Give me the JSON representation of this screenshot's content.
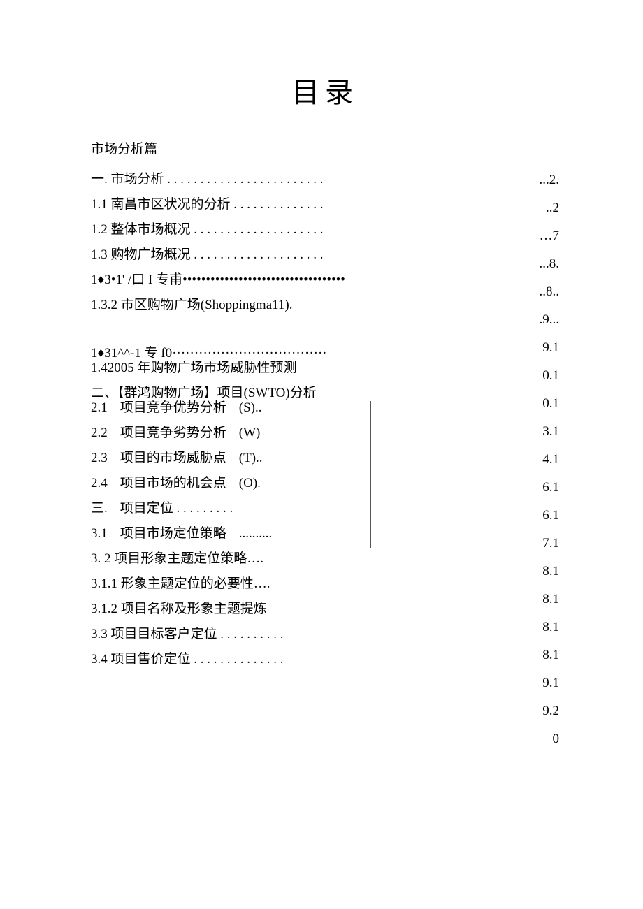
{
  "title": "目录",
  "section_heading": "市场分析篇",
  "left": [
    {
      "text": "一. 市场分析 . . . . . . . . . . . . . . . . . . . . . . . ."
    },
    {
      "text": "1.1 南昌市区状况的分析 . . . . . . . . . . . . . ."
    },
    {
      "text": "1.2 整体市场概况 . . . . . . . . . . . . . . . . . . . ."
    },
    {
      "text": "1.3 购物广场概况 . . . . . . . . . . . . . . . . . . . ."
    },
    {
      "text": "1♦3•1' /口 I 专甫•••••••••••••••••••••••••••••••••••"
    },
    {
      "text": "1.3.2 市区购物广场(Shoppingma11)."
    },
    {
      "text": "",
      "gap_before": true,
      "tight": true,
      "raw": "1♦31^^-1 专 f0···································"
    },
    {
      "text": "1.42005 年购物广场市场威胁性预测"
    },
    {
      "text": "二、【群鸿购物广场】项目(SWTO)分析",
      "tight": true
    }
  ],
  "divider_block": [
    {
      "num": "2.1",
      "label": "项目竞争优势分析",
      "suffix": "(S).."
    },
    {
      "num": "2.2",
      "label": "项目竞争劣势分析",
      "suffix": "(W)"
    },
    {
      "num": "2.3",
      "label": "项目的市场威胁点",
      "suffix": "(T).."
    },
    {
      "num": "2.4",
      "label": "项目市场的机会点",
      "suffix": "(O)."
    },
    {
      "num": "三.",
      "label": "项目定位 . . . . . . . . .",
      "suffix": ""
    },
    {
      "num": "3.1",
      "label": "项目市场定位策略",
      "suffix": "..........",
      "suffix_narrow": true
    }
  ],
  "left2": [
    {
      "text": "3.   2 项目形象主题定位策略…."
    },
    {
      "text": "3.1.1   形象主题定位的必要性…."
    },
    {
      "text": "3.1.2   项目名称及形象主题提炼"
    },
    {
      "text": "3.3 项目目标客户定位 . . . . . . . . . ."
    },
    {
      "text": "3.4 项目售价定位 . . . . . . . . . . . . . ."
    }
  ],
  "pages": [
    "...2.",
    "..2",
    "…7",
    "...8.",
    "..8..",
    ".9...",
    "9.1",
    "0.1",
    "0.1",
    "3.1",
    "4.1",
    "6.1",
    "6.1",
    "7.1",
    "8.1",
    "8.1",
    "8.1",
    "8.1",
    "9.1",
    "9.2",
    "0"
  ]
}
